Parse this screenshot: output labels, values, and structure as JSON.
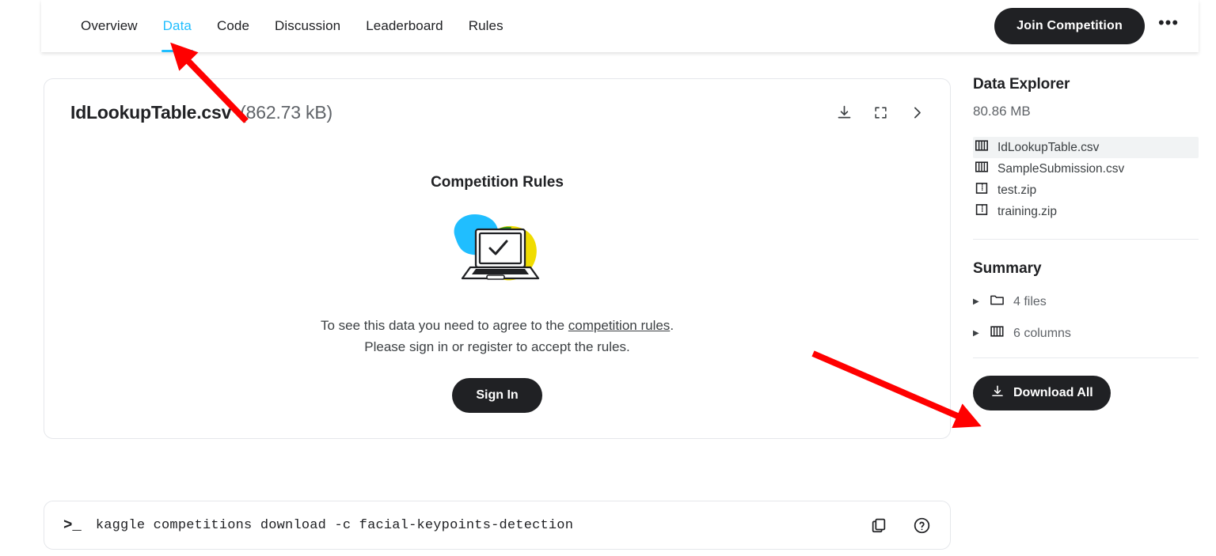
{
  "nav": {
    "tabs": [
      {
        "label": "Overview",
        "active": false
      },
      {
        "label": "Data",
        "active": true
      },
      {
        "label": "Code",
        "active": false
      },
      {
        "label": "Discussion",
        "active": false
      },
      {
        "label": "Leaderboard",
        "active": false
      },
      {
        "label": "Rules",
        "active": false
      }
    ],
    "join_label": "Join Competition",
    "more_label": "•••",
    "active_color": "#20beff"
  },
  "file_header": {
    "filename": "IdLookupTable.csv",
    "filesize": "(862.73 kB)",
    "icons": [
      "download-icon",
      "fullscreen-icon",
      "chevron-right-icon"
    ]
  },
  "rules_state": {
    "title": "Competition Rules",
    "text_before_link": "To see this data you need to agree to the ",
    "link_label": "competition rules",
    "text_after_link": ".",
    "line2": "Please sign in or register to accept the rules.",
    "signin_label": "Sign In"
  },
  "command_bar": {
    "prompt": ">_",
    "command": "kaggle competitions download -c facial-keypoints-detection",
    "copy_label": "copy-icon",
    "help_label": "help-icon"
  },
  "sidebar": {
    "title": "Data Explorer",
    "total_size": "80.86 MB",
    "files": [
      {
        "name": "IdLookupTable.csv",
        "type": "csv",
        "selected": true
      },
      {
        "name": "SampleSubmission.csv",
        "type": "csv",
        "selected": false
      },
      {
        "name": "test.zip",
        "type": "zip",
        "selected": false
      },
      {
        "name": "training.zip",
        "type": "zip",
        "selected": false
      }
    ],
    "summary_title": "Summary",
    "summary_items": [
      {
        "label": "4 files",
        "icon": "folder-icon"
      },
      {
        "label": "6 columns",
        "icon": "table-icon"
      }
    ],
    "download_all_label": "Download All"
  },
  "annotations": {
    "arrow_color": "#ff0000",
    "arrows": [
      {
        "name": "arrow-to-data-tab",
        "target": "Data tab"
      },
      {
        "name": "arrow-to-download-all",
        "target": "Download All button"
      }
    ]
  }
}
